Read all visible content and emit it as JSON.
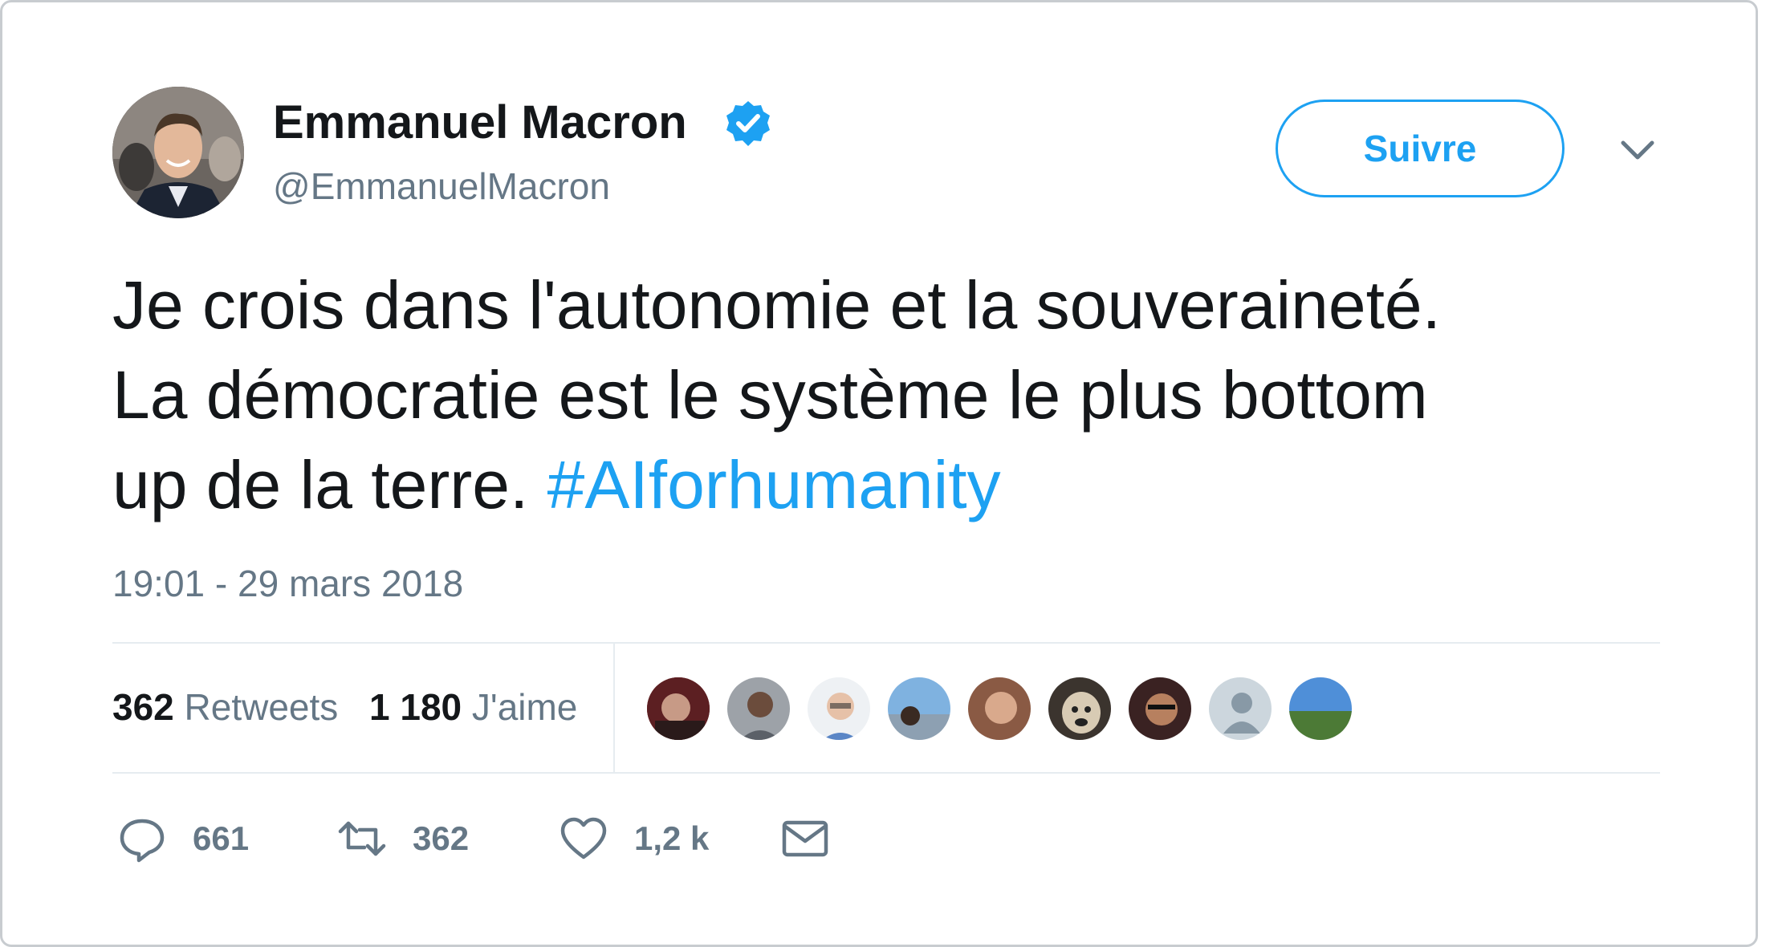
{
  "author": {
    "name": "Emmanuel Macron",
    "handle": "@EmmanuelMacron",
    "verified_icon": "verified-badge-icon",
    "avatar_icon": "profile-photo"
  },
  "header": {
    "follow_label": "Suivre",
    "menu_icon": "chevron-down-icon"
  },
  "tweet": {
    "line1": "Je crois dans l'autonomie et la souveraineté.",
    "line2": "La démocratie est le système le plus bottom",
    "line3": "up de la terre.",
    "hashtag": "#AIforhumanity",
    "timestamp": "19:01 - 29 mars 2018"
  },
  "stats": {
    "retweets_count": "362",
    "retweets_label": "Retweets",
    "likes_count": "1 180",
    "likes_label": "J'aime",
    "liker_avatars": [
      "liker-avatar-1",
      "liker-avatar-2",
      "liker-avatar-3",
      "liker-avatar-4",
      "liker-avatar-5",
      "liker-avatar-6",
      "liker-avatar-7",
      "liker-avatar-8",
      "liker-avatar-9"
    ]
  },
  "actions": {
    "reply_count": "661",
    "retweet_count": "362",
    "like_count": "1,2 k"
  },
  "colors": {
    "accent": "#1da1f2",
    "text": "#14171a",
    "secondary": "#657786",
    "divider": "#e6ecf0"
  }
}
